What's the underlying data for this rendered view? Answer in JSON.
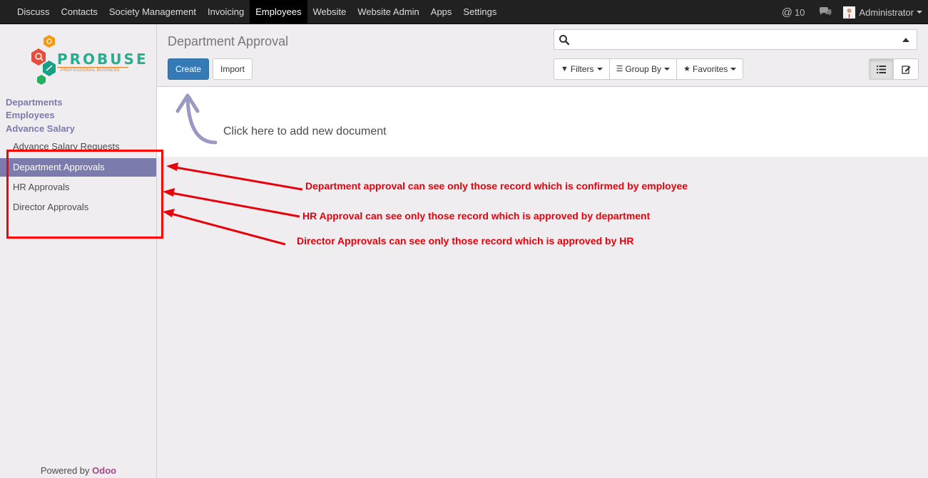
{
  "topbar": {
    "menu": [
      "Discuss",
      "Contacts",
      "Society Management",
      "Invoicing",
      "Employees",
      "Website",
      "Website Admin",
      "Apps",
      "Settings"
    ],
    "active_menu": "Employees",
    "notifications_count": "10",
    "user_name": "Administrator"
  },
  "sidebar": {
    "logo_brand": "PROBUSE",
    "logo_tagline": "PROFESSIONAL BUSINESS",
    "sections": [
      "Departments",
      "Employees",
      "Advance Salary"
    ],
    "items": [
      "Advance Salary Requests",
      "Department Approvals",
      "HR Approvals",
      "Director Approvals"
    ],
    "active_item": "Department Approvals",
    "powered_by": "Powered by",
    "powered_brand": "Odoo"
  },
  "control_panel": {
    "title": "Department Approval",
    "create_label": "Create",
    "import_label": "Import",
    "search_value": "",
    "filters_label": "Filters",
    "groupby_label": "Group By",
    "favorites_label": "Favorites",
    "active_view": "list"
  },
  "helper": {
    "text": "Click here to add new document"
  },
  "annotations": {
    "notes": [
      "Department approval can see only  those record which is confirmed by employee",
      "HR Approval can see only those record which is approved by department",
      "Director Approvals can see only those record which is approved by HR"
    ],
    "color": "#e8000b"
  },
  "colors": {
    "accent": "#7c7bad",
    "primary_button": "#337ab7",
    "topbar": "#212121",
    "odoo_brand": "#a24689"
  }
}
